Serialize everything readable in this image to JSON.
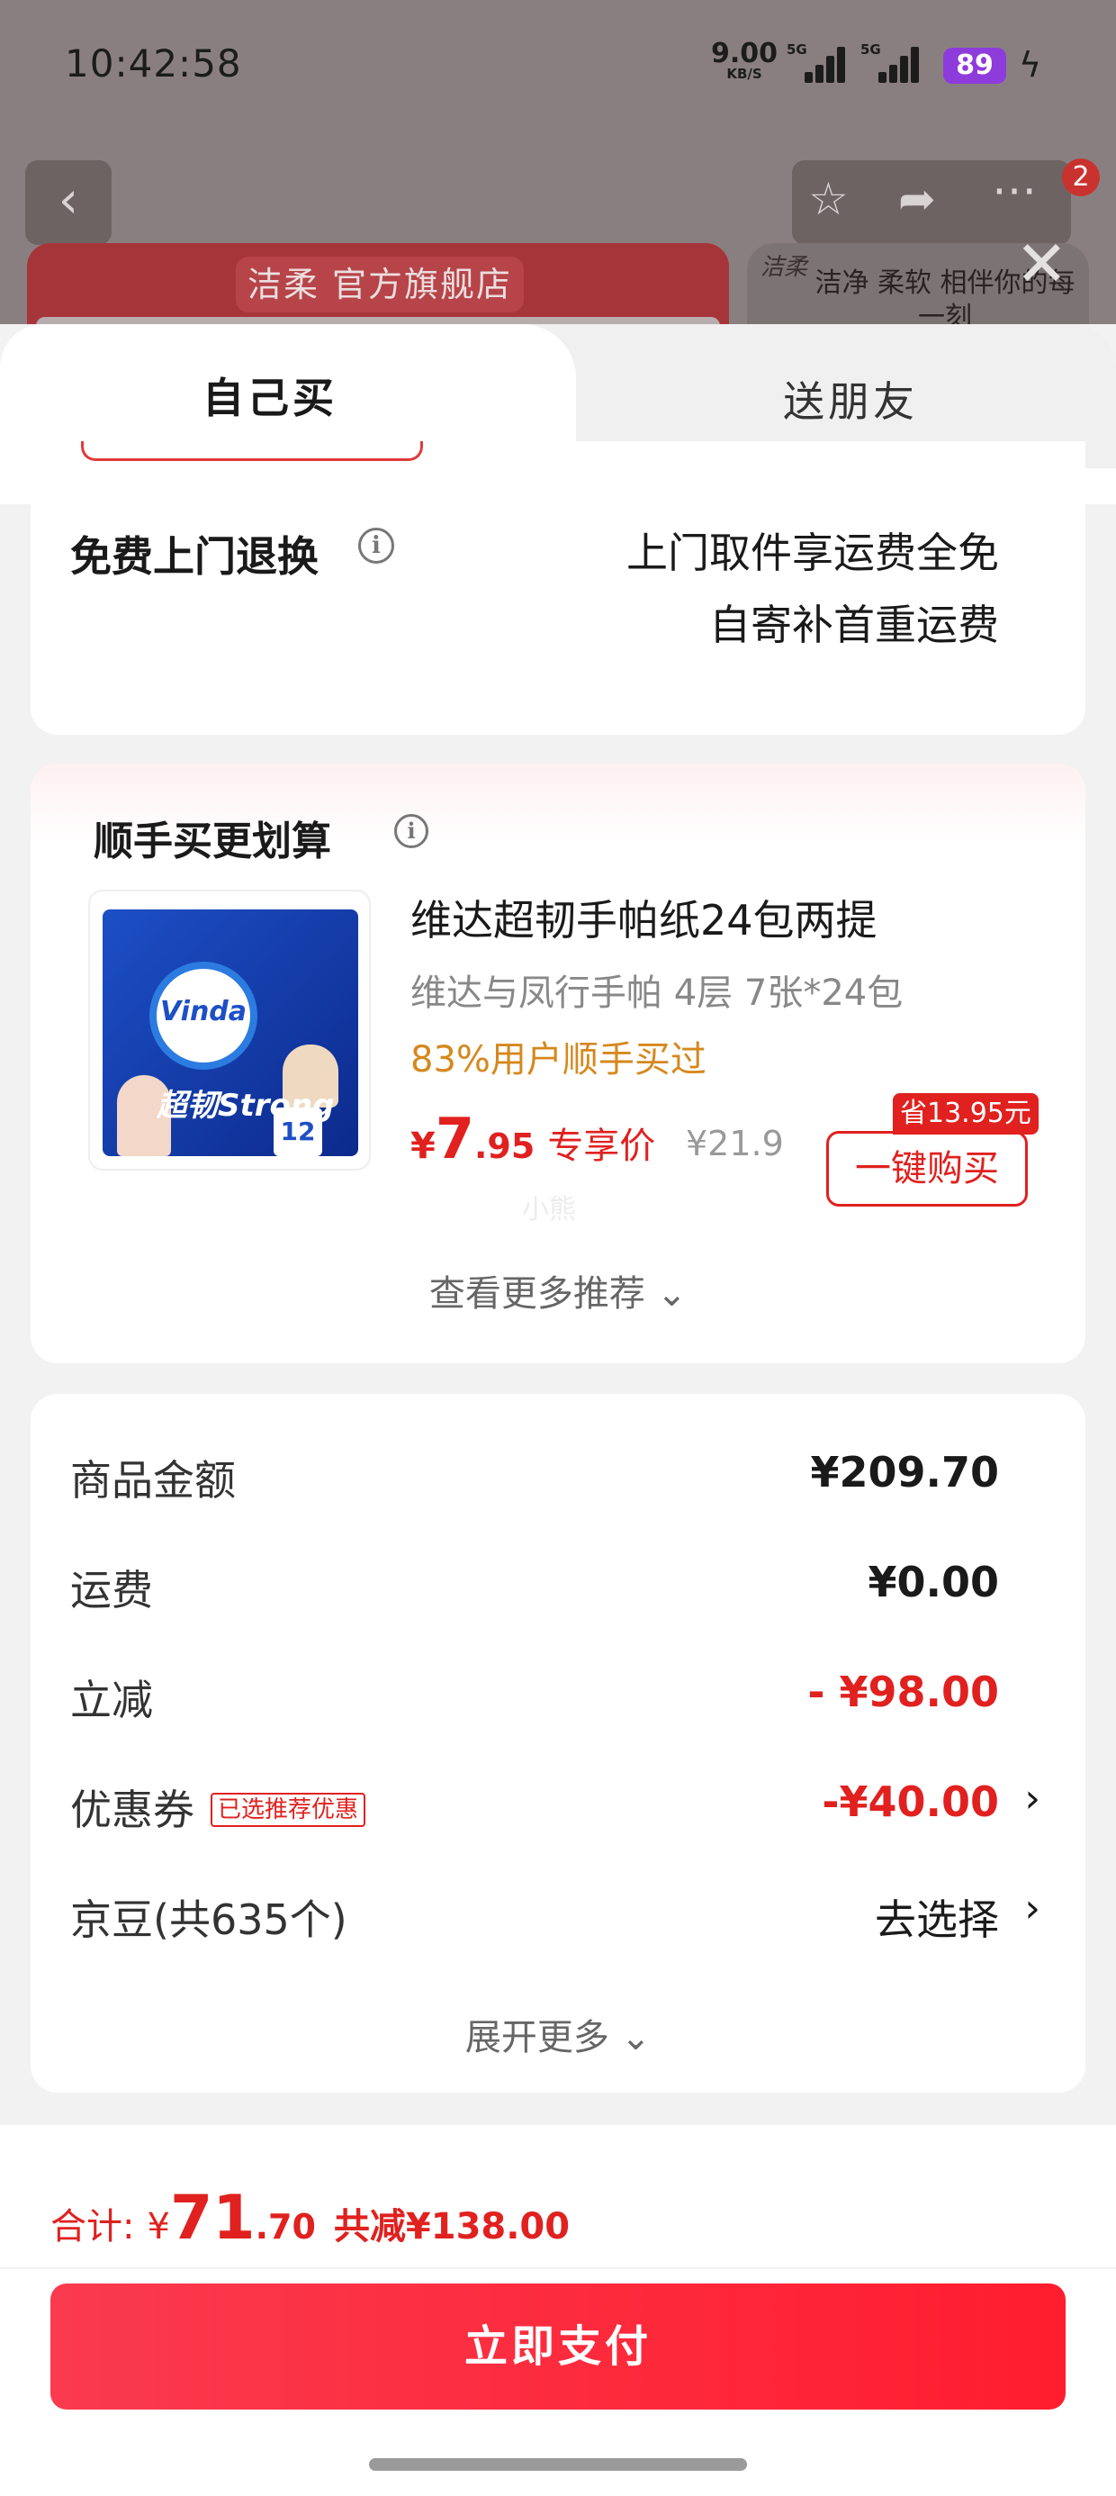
{
  "status_bar": {
    "time": "10:42:58",
    "net_speed": "9.00",
    "net_unit": "KB/S",
    "sim1_label": "5G",
    "sim2_label": "5G",
    "battery": "89"
  },
  "background_page": {
    "store_name": "洁柔 官方旗舰店",
    "brand_logo": "洁柔",
    "brand_slogan": "洁净 柔软 相伴你的每一刻",
    "cart_count": "2"
  },
  "tabs": {
    "self": "自己买",
    "friend": "送朋友"
  },
  "return_service": {
    "title": "免费上门退换",
    "line1": "上门取件享运费全免",
    "line2": "自寄补首重运费"
  },
  "recommendation": {
    "title": "顺手买更划算",
    "product": {
      "name": "维达超韧手帕纸24包两提",
      "spec": "维达与凤行手帕 4层 7张*24包",
      "rate": "83%用户顺手买过",
      "price_symbol": "¥",
      "price_int": "7",
      "price_dec": ".95",
      "price_tag": "专享价",
      "original_price": "¥21.9",
      "save_badge": "省13.95元",
      "buy_button": "一键购买",
      "pack_brand": "Vinda",
      "pack_text": "超韧Strong",
      "pack_count": "12"
    },
    "watermark": "小熊",
    "more": "查看更多推荐 ⌄"
  },
  "summary": {
    "rows": [
      {
        "label": "商品金额",
        "value": "¥209.70"
      },
      {
        "label": "运费",
        "value": "¥0.00"
      },
      {
        "label": "立减",
        "value": "- ¥98.00"
      },
      {
        "label": "优惠券",
        "tag": "已选推荐优惠",
        "value": "-¥40.00"
      },
      {
        "label": "京豆(共635个)",
        "value": "去选择"
      }
    ],
    "expand": "展开更多 ⌄"
  },
  "footer": {
    "total_label": "合计:",
    "total_yen": "¥",
    "total_int": "71",
    "total_dec": ".70",
    "total_reduce": "共减¥138.00",
    "pay_button": "立即支付"
  },
  "colors": {
    "accent": "#e0211f",
    "pay_gradient_start": "#fa3a4e",
    "pay_gradient_end": "#ff1d2e",
    "rate_orange": "#d5881e"
  },
  "icons": [
    "back-arrow-icon",
    "star-icon",
    "share-icon",
    "more-icon",
    "close-icon",
    "info-icon",
    "chevron-right-icon",
    "lightning-icon"
  ]
}
